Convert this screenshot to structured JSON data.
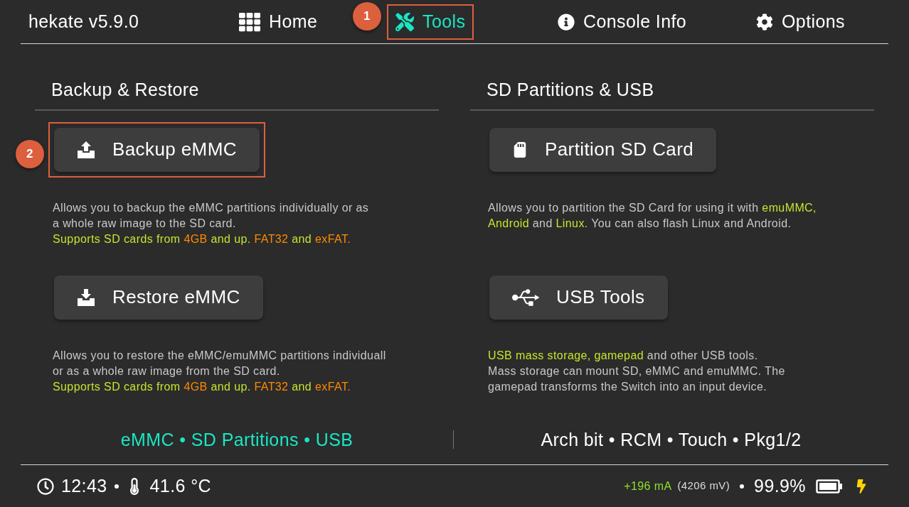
{
  "header": {
    "title": "hekate v5.9.0",
    "nav": [
      {
        "label": "Home",
        "selected": false,
        "highlighted": false
      },
      {
        "label": "Tools",
        "selected": true,
        "highlighted": true,
        "marker": "1"
      },
      {
        "label": "Console Info",
        "selected": false,
        "highlighted": false
      },
      {
        "label": "Options",
        "selected": false,
        "highlighted": false
      }
    ]
  },
  "sections": [
    {
      "title": "Backup & Restore",
      "tools": [
        {
          "label": "Backup eMMC",
          "highlighted": true,
          "marker": "2",
          "description": [
            [
              {
                "text": "Allows you to backup the eMMC partitions individually or as",
                "color": "#c8c8c8"
              }
            ],
            [
              {
                "text": "a whole raw image to the SD card.",
                "color": "#c8c8c8"
              }
            ],
            [
              {
                "text": "Supports SD cards from ",
                "color": "#c6e32c"
              },
              {
                "text": "4GB",
                "color": "#ff8a00"
              },
              {
                "text": " and up. ",
                "color": "#c6e32c"
              },
              {
                "text": "FAT32",
                "color": "#ff8a00"
              },
              {
                "text": " and ",
                "color": "#c6e32c"
              },
              {
                "text": "exFAT.",
                "color": "#ff8a00"
              }
            ]
          ]
        },
        {
          "label": "Restore eMMC",
          "highlighted": false,
          "description": [
            [
              {
                "text": "Allows you to restore the eMMC/emuMMC partitions individuall",
                "color": "#c8c8c8"
              }
            ],
            [
              {
                "text": "or as a whole raw image from the SD card.",
                "color": "#c8c8c8"
              }
            ],
            [
              {
                "text": "Supports SD cards from ",
                "color": "#c6e32c"
              },
              {
                "text": "4GB",
                "color": "#ff8a00"
              },
              {
                "text": " and up. ",
                "color": "#c6e32c"
              },
              {
                "text": "FAT32",
                "color": "#ff8a00"
              },
              {
                "text": " and ",
                "color": "#c6e32c"
              },
              {
                "text": "exFAT.",
                "color": "#ff8a00"
              }
            ]
          ]
        }
      ]
    },
    {
      "title": "SD Partitions & USB",
      "tools": [
        {
          "label": "Partition SD Card",
          "highlighted": false,
          "description": [
            [
              {
                "text": "Allows you to partition the SD Card for using it with ",
                "color": "#c8c8c8"
              },
              {
                "text": "emuMMC,",
                "color": "#c6e32c"
              }
            ],
            [
              {
                "text": "Android",
                "color": "#c6e32c"
              },
              {
                "text": " and ",
                "color": "#c8c8c8"
              },
              {
                "text": "Linux",
                "color": "#c6e32c"
              },
              {
                "text": ". You can also flash Linux and Android.",
                "color": "#c8c8c8"
              }
            ]
          ]
        },
        {
          "label": "USB Tools",
          "highlighted": false,
          "description": [
            [
              {
                "text": "USB mass storage, gamepad",
                "color": "#c6e32c"
              },
              {
                "text": " and other USB tools.",
                "color": "#c8c8c8"
              }
            ],
            [
              {
                "text": "Mass storage can mount SD, eMMC and emuMMC. The",
                "color": "#c8c8c8"
              }
            ],
            [
              {
                "text": "gamepad transforms the Switch into an input device.",
                "color": "#c8c8c8"
              }
            ]
          ]
        }
      ]
    }
  ],
  "footer": {
    "left": "eMMC • SD Partitions • USB",
    "right": "Arch bit • RCM • Touch • Pkg1/2"
  },
  "status_bar": {
    "time": "12:43",
    "temperature": "41.6 °C",
    "current": "+196 mA",
    "voltage": "(4206 mV)",
    "battery": "99.9%",
    "charging": true
  }
}
